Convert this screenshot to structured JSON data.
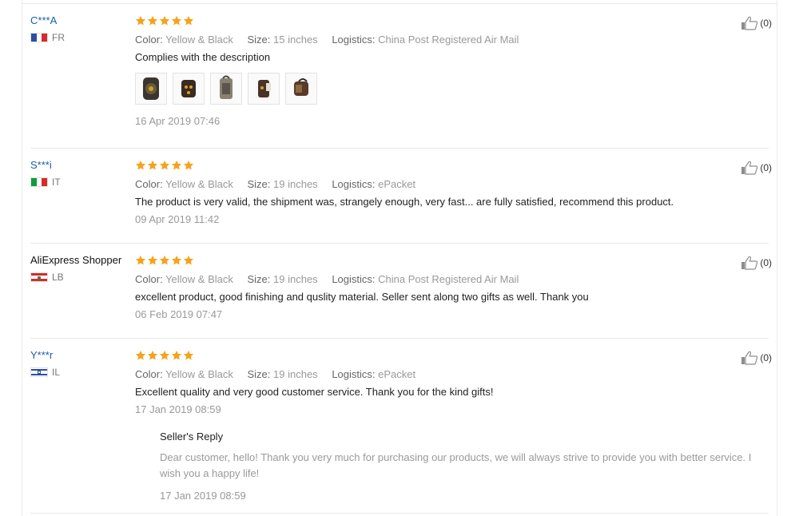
{
  "labels": {
    "color": "Color:",
    "size": "Size:",
    "logistics": "Logistics:",
    "reply_title": "Seller's Reply"
  },
  "colors": {
    "username_masked": "#1a5fa8",
    "star": "#f7a21b",
    "divider": "#e8e8e8"
  },
  "icons": {
    "star": "star-icon",
    "like": "thumbs-up-icon"
  },
  "reviews": [
    {
      "user": "C***A",
      "country": "FR",
      "stars": 5,
      "color": "Yellow & Black",
      "size": "15 inches",
      "logistics": "China Post Registered Air Mail",
      "text": "Complies with the description",
      "date": "16 Apr 2019 07:46",
      "likes": "(0)",
      "photo_count": 5
    },
    {
      "user": "S***i",
      "country": "IT",
      "stars": 5,
      "color": "Yellow & Black",
      "size": "19 inches",
      "logistics": "ePacket",
      "text": "The product is very valid, the shipment was, strangely enough, very fast... are fully satisfied, recommend this product.",
      "date": "09 Apr 2019 11:42",
      "likes": "(0)"
    },
    {
      "user": "AliExpress Shopper",
      "country": "LB",
      "stars": 5,
      "color": "Yellow & Black",
      "size": "19 inches",
      "logistics": "China Post Registered Air Mail",
      "text": "excellent product, good finishing and quslity material. Seller sent along two gifts as well. Thank you",
      "date": "06 Feb 2019 07:47",
      "likes": "(0)"
    },
    {
      "user": "Y***r",
      "country": "IL",
      "stars": 5,
      "color": "Yellow & Black",
      "size": "19 inches",
      "logistics": "ePacket",
      "text": "Excellent quality and very good customer service. Thank you for the kind gifts!",
      "date": "17 Jan 2019 08:59",
      "likes": "(0)",
      "reply": {
        "text": "Dear customer, hello! Thank you very much for purchasing our products, we will always strive to provide you with better service. I wish you a happy life!",
        "date": "17 Jan 2019 08:59"
      }
    }
  ]
}
